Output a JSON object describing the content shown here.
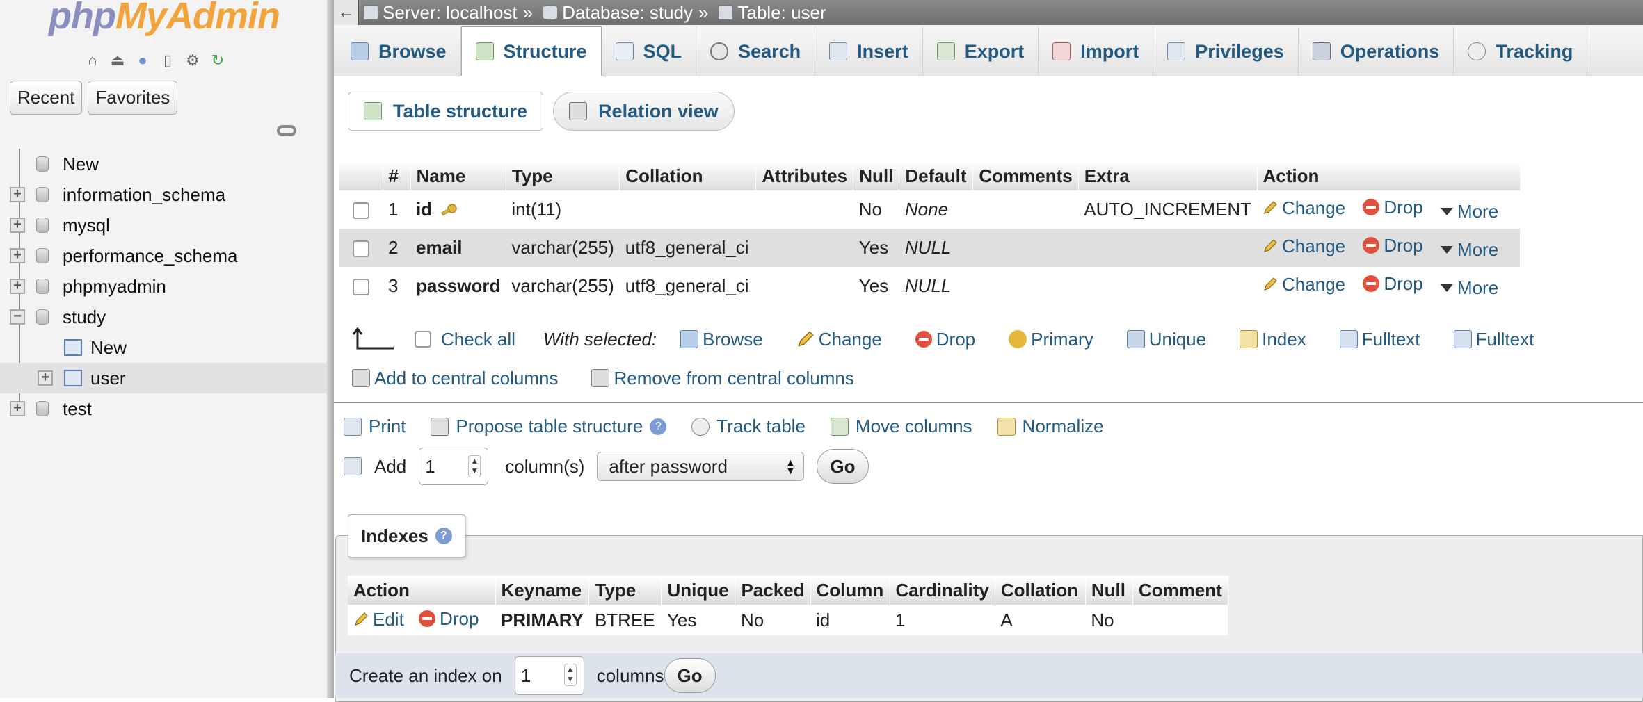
{
  "nav": {
    "logo_php": "php",
    "logo_my": "MyAdmin",
    "tabs": [
      "Recent",
      "Favorites"
    ],
    "tree": [
      {
        "label": "New",
        "kind": "new"
      },
      {
        "label": "information_schema",
        "kind": "db"
      },
      {
        "label": "mysql",
        "kind": "db"
      },
      {
        "label": "performance_schema",
        "kind": "db"
      },
      {
        "label": "phpmyadmin",
        "kind": "db"
      },
      {
        "label": "study",
        "kind": "db-open"
      },
      {
        "label": "New",
        "kind": "table-new"
      },
      {
        "label": "user",
        "kind": "table"
      },
      {
        "label": "test",
        "kind": "db"
      }
    ]
  },
  "breadcrumb": {
    "server": "Server: localhost",
    "database": "Database: study",
    "table": "Table: user",
    "separator": "»"
  },
  "tabs": [
    "Browse",
    "Structure",
    "SQL",
    "Search",
    "Insert",
    "Export",
    "Import",
    "Privileges",
    "Operations",
    "Tracking"
  ],
  "active_tab": "Structure",
  "subtabs": [
    "Table structure",
    "Relation view"
  ],
  "structure": {
    "headers": [
      "#",
      "Name",
      "Type",
      "Collation",
      "Attributes",
      "Null",
      "Default",
      "Comments",
      "Extra",
      "Action"
    ],
    "rows": [
      {
        "num": "1",
        "name": "id",
        "type": "int(11)",
        "collation": "",
        "attributes": "",
        "null": "No",
        "default": "None",
        "comments": "",
        "extra": "AUTO_INCREMENT"
      },
      {
        "num": "2",
        "name": "email",
        "type": "varchar(255)",
        "collation": "utf8_general_ci",
        "attributes": "",
        "null": "Yes",
        "default": "NULL",
        "comments": "",
        "extra": ""
      },
      {
        "num": "3",
        "name": "password",
        "type": "varchar(255)",
        "collation": "utf8_general_ci",
        "attributes": "",
        "null": "Yes",
        "default": "NULL",
        "comments": "",
        "extra": ""
      }
    ],
    "actions": {
      "change": "Change",
      "drop": "Drop",
      "more": "More"
    }
  },
  "with_selected": {
    "check_all": "Check all",
    "label": "With selected:",
    "items": [
      "Browse",
      "Change",
      "Drop",
      "Primary",
      "Unique",
      "Index",
      "Fulltext",
      "Fulltext"
    ],
    "row2": [
      "Add to central columns",
      "Remove from central columns"
    ]
  },
  "tools": {
    "print": "Print",
    "propose": "Propose table structure",
    "track": "Track table",
    "move": "Move columns",
    "normalize": "Normalize"
  },
  "add_column": {
    "label": "Add",
    "count": "1",
    "unit": "column(s)",
    "position": "after password",
    "go": "Go"
  },
  "indexes": {
    "legend": "Indexes",
    "headers": [
      "Action",
      "Keyname",
      "Type",
      "Unique",
      "Packed",
      "Column",
      "Cardinality",
      "Collation",
      "Null",
      "Comment"
    ],
    "rows": [
      {
        "edit": "Edit",
        "drop": "Drop",
        "keyname": "PRIMARY",
        "type": "BTREE",
        "unique": "Yes",
        "packed": "No",
        "column": "id",
        "cardinality": "1",
        "collation": "A",
        "null": "No",
        "comment": ""
      }
    ]
  },
  "create_index": {
    "label": "Create an index on",
    "count": "1",
    "unit": "columns",
    "go": "Go"
  }
}
